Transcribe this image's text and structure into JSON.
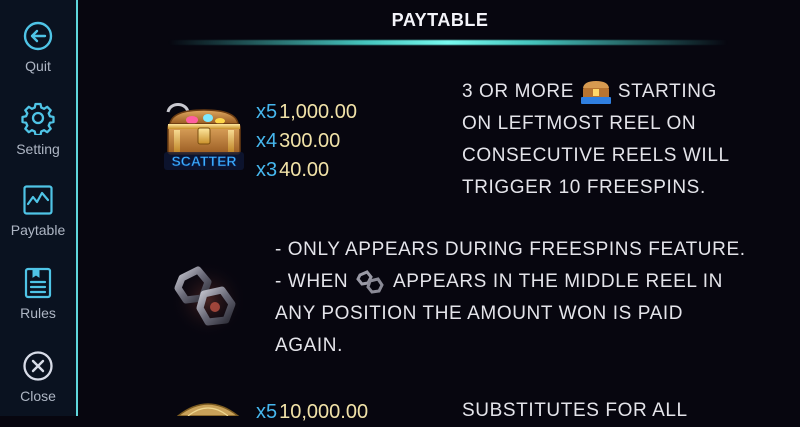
{
  "sidebar": {
    "items": [
      {
        "label": "Quit",
        "icon": "quit-icon"
      },
      {
        "label": "Setting",
        "icon": "gear-icon"
      },
      {
        "label": "Paytable",
        "icon": "paytable-chart-icon"
      },
      {
        "label": "Rules",
        "icon": "rules-document-icon"
      },
      {
        "label": "Close",
        "icon": "close-icon"
      }
    ]
  },
  "header": {
    "title": "PAYTABLE"
  },
  "scatter": {
    "symbol_label": "SCATTER",
    "payouts": [
      {
        "mult": "x5",
        "amount": "1,000.00"
      },
      {
        "mult": "x4",
        "amount": "300.00"
      },
      {
        "mult": "x3",
        "amount": "40.00"
      }
    ],
    "desc_line1_pre": "3 OR MORE",
    "desc_line1_post": "STARTING",
    "desc_line2": "ON LEFTMOST REEL ON",
    "desc_line3": "CONSECUTIVE REELS WILL",
    "desc_line4": "TRIGGER 10 FREESPINS."
  },
  "special": {
    "line1": "- ONLY APPEARS DURING FREESPINS FEATURE.",
    "line2_pre": "- WHEN",
    "line2_post": "APPEARS IN THE MIDDLE REEL IN",
    "line3": "ANY POSITION THE AMOUNT WON IS PAID",
    "line4": "AGAIN."
  },
  "wild": {
    "mult": "x5",
    "amount": "10,000.00",
    "desc": "SUBSTITUTES FOR ALL"
  },
  "colors": {
    "accent": "#5fd6dc",
    "multiplier": "#46b7ee",
    "amount": "#f1e2a8"
  }
}
